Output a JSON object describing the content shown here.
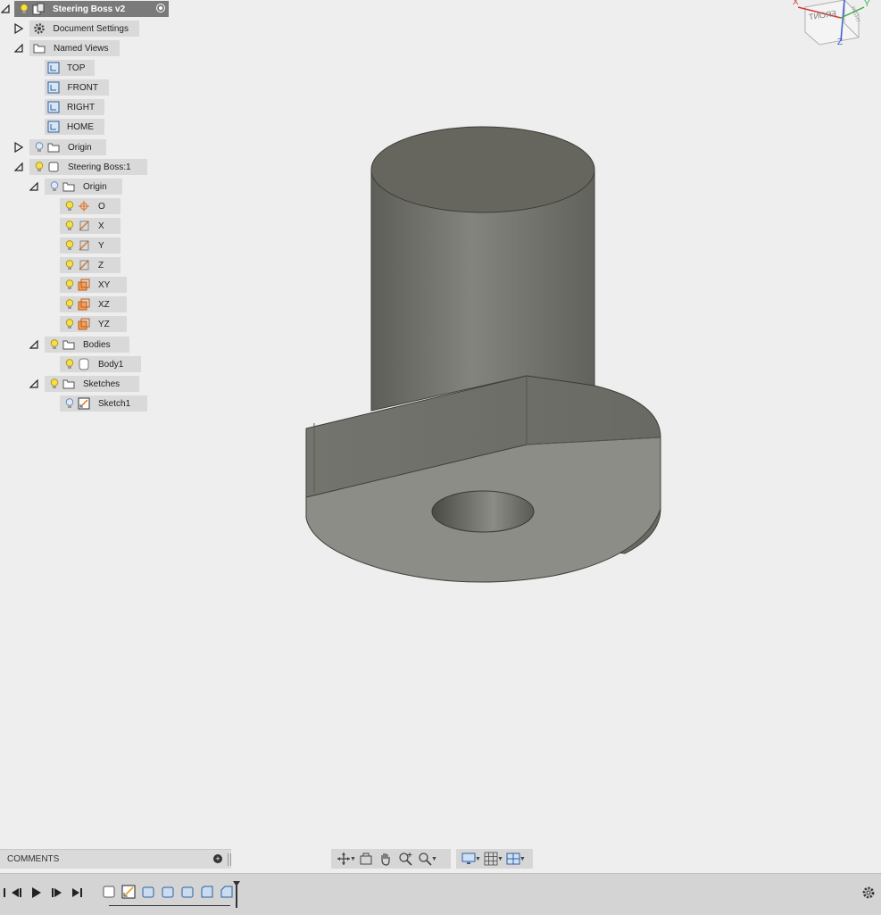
{
  "browser": {
    "root_label": "Steering Boss v2",
    "document_settings": "Document Settings",
    "named_views": "Named Views",
    "views": [
      "TOP",
      "FRONT",
      "RIGHT",
      "HOME"
    ],
    "origin_label": "Origin",
    "component_label": "Steering Boss:1",
    "component_origin_label": "Origin",
    "origin_items": [
      "O",
      "X",
      "Y",
      "Z",
      "XY",
      "XZ",
      "YZ"
    ],
    "bodies_label": "Bodies",
    "body_item": "Body1",
    "sketches_label": "Sketches",
    "sketch_item": "Sketch1"
  },
  "viewcube": {
    "face_label": "FRONT",
    "side_label": "RIGHT",
    "axes": [
      "X",
      "Y",
      "Z"
    ]
  },
  "comments": {
    "label": "COMMENTS"
  },
  "colors": {
    "body_top": "#8b8b85",
    "body_side": "#6f6f69",
    "tree_item_bg": "#d9d9d9",
    "root_bg": "#7a7a7a",
    "background": "#eeeeee"
  }
}
